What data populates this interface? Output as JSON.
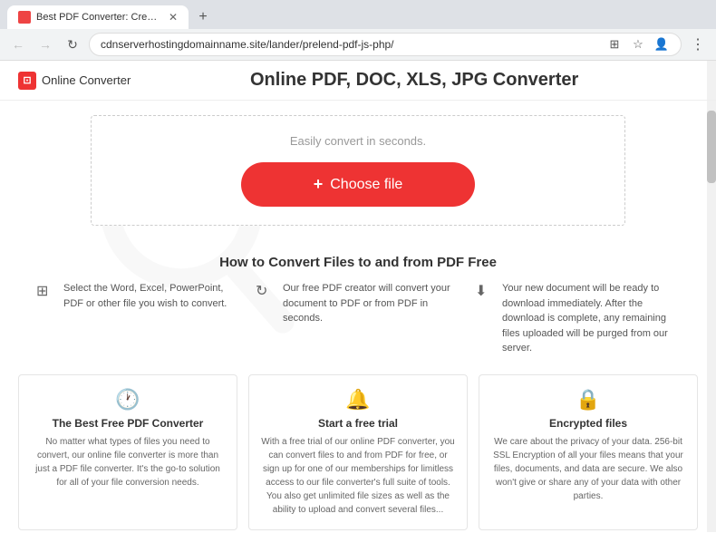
{
  "browser": {
    "tab_title": "Best PDF Converter: Create, Conv...",
    "url": "cdnserverhostingdomainname.site/lander/prelend-pdf-js-php/",
    "new_tab_icon": "+",
    "nav": {
      "back": "←",
      "forward": "→",
      "refresh": "↺"
    }
  },
  "header": {
    "logo_text": "Online Converter",
    "title": "Online PDF, DOC, XLS, JPG Converter"
  },
  "converter": {
    "subtitle": "Easily convert in seconds.",
    "button_label": "Choose file",
    "button_plus": "+"
  },
  "how_to": {
    "title": "How to Convert Files to and from PDF Free",
    "steps": [
      {
        "icon": "⊞",
        "text": "Select the Word, Excel, PowerPoint, PDF or other file you wish to convert."
      },
      {
        "icon": "↻",
        "text": "Our free PDF creator will convert your document to PDF or from PDF in seconds."
      },
      {
        "icon": "⬇",
        "text": "Your new document will be ready to download immediately. After the download is complete, any remaining files uploaded will be purged from our server."
      }
    ]
  },
  "features": [
    {
      "icon": "🕐",
      "title": "The Best Free PDF Converter",
      "desc": "No matter what types of files you need to convert, our online file converter is more than just a PDF file converter. It's the go-to solution for all of your file conversion needs."
    },
    {
      "icon": "🔔",
      "title": "Start a free trial",
      "desc": "With a free trial of our online PDF converter, you can convert files to and from PDF for free, or sign up for one of our memberships for limitless access to our file converter's full suite of tools. You also get unlimited file sizes as well as the ability to upload and convert several files..."
    },
    {
      "icon": "🔒",
      "title": "Encrypted files",
      "desc": "We care about the privacy of your data. 256-bit SSL Encryption of all your files means that your files, documents, and data are secure. We also won't give or share any of your data with other parties."
    }
  ]
}
